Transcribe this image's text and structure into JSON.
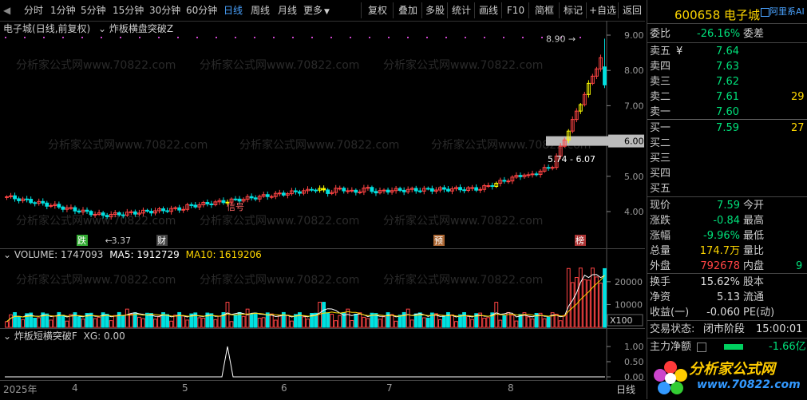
{
  "toolbar": {
    "periods": [
      "分时",
      "1分钟",
      "5分钟",
      "15分钟",
      "30分钟",
      "60分钟",
      "日线",
      "周线",
      "月线",
      "更多"
    ],
    "active_period": "日线",
    "more_arrow": "▼",
    "right_buttons": [
      "复权",
      "叠加",
      "多股",
      "统计",
      "画线",
      "F10",
      "简框",
      "标记",
      "+自选",
      "返回"
    ]
  },
  "main": {
    "stock_label": "电子城",
    "mode_label": "(日线,前复权)",
    "indicator_label": "炸板横盘突破Z",
    "price_high_label": "8.90",
    "price_low_label": "3.37",
    "range_label": "5.74 - 6.07",
    "signal_label": "信号",
    "markers": [
      "跌",
      "财",
      "预",
      "榜"
    ],
    "y_ticks": [
      "9.00",
      "8.00",
      "7.00",
      "6.00",
      "5.00",
      "4.00"
    ],
    "highlight_tick": "6.00"
  },
  "volume": {
    "label": "VOLUME: 1747093",
    "ma5": "MA5: 1912729",
    "ma10": "MA10: 1619206",
    "y_ticks": [
      "20000",
      "10000"
    ],
    "unit": "X100"
  },
  "indicator": {
    "label": "炸板短横突破F",
    "xg": "XG: 0.00",
    "y_ticks": [
      "1.00",
      "0.50",
      "0.00"
    ]
  },
  "date_axis": {
    "labels": [
      "2025年",
      "4",
      "5",
      "6",
      "7",
      "8"
    ],
    "period": "日线"
  },
  "watermark": "分析家公式网www.70822.com",
  "panel": {
    "code": "600658",
    "name": "电子城",
    "ali_text": "阿里系AI",
    "weibi_label": "委比",
    "weibi_value": "-26.16%",
    "weicha_label": "委差",
    "sell": [
      {
        "label": "卖五",
        "yen": "¥",
        "price": "7.64"
      },
      {
        "label": "卖四",
        "price": "7.63"
      },
      {
        "label": "卖三",
        "price": "7.62"
      },
      {
        "label": "卖二",
        "price": "7.61",
        "vol": "29"
      },
      {
        "label": "卖一",
        "price": "7.60"
      }
    ],
    "buy": [
      {
        "label": "买一",
        "price": "7.59",
        "vol": "27"
      },
      {
        "label": "买二",
        "price": ""
      },
      {
        "label": "买三",
        "price": ""
      },
      {
        "label": "买四",
        "price": ""
      },
      {
        "label": "买五",
        "price": ""
      }
    ],
    "stats": [
      {
        "l": "现价",
        "v": "7.59",
        "vc": "dn",
        "l2": "今开"
      },
      {
        "l": "涨跌",
        "v": "-0.84",
        "vc": "dn",
        "l2": "最高"
      },
      {
        "l": "涨幅",
        "v": "-9.96%",
        "vc": "dn",
        "l2": "最低"
      },
      {
        "l": "总量",
        "v": "174.7万",
        "vc": "yel",
        "l2": "量比"
      },
      {
        "l": "外盘",
        "v": "792678",
        "vc": "up",
        "l2": "内盘",
        "v2": "9"
      }
    ],
    "stats2": [
      {
        "l": "换手",
        "v": "15.62%",
        "l2": "股本"
      },
      {
        "l": "净资",
        "v": "5.13",
        "l2": "流通"
      },
      {
        "l": "收益(一)",
        "v": "-0.060",
        "l2": "PE(动)"
      }
    ],
    "trade_state_label": "交易状态:",
    "trade_state": "闭市阶段",
    "trade_time": "15:00:01",
    "net_label": "主力净额",
    "net_value": "-1.66亿",
    "logo_text": "分析家公式网",
    "logo_url": "www.70822.com"
  },
  "colors": {
    "up": "#ff4444",
    "down": "#00e0e0",
    "ma5": "#ffffff",
    "ma10": "#ffd700",
    "signal_yellow": "#ffff00"
  }
}
